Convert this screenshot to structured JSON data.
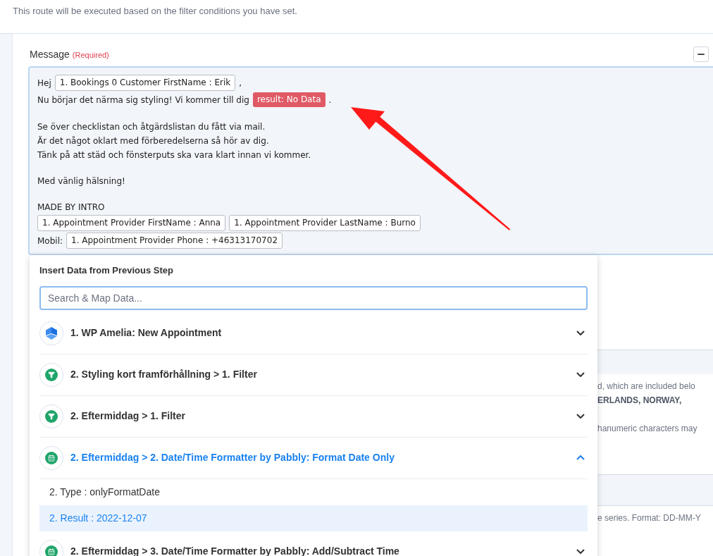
{
  "route_note": "This route will be executed based on the filter conditions you have set.",
  "message": {
    "label": "Message",
    "required": "(Required)",
    "paragraphs": [
      [
        [
          {
            "kind": "text",
            "text": "Hej"
          },
          {
            "kind": "token",
            "text": "1. Bookings 0 Customer FirstName : Erik"
          },
          {
            "kind": "text",
            "text": ","
          }
        ],
        [
          {
            "kind": "text",
            "text": "Nu börjar det närma sig styling! Vi kommer till dig"
          },
          {
            "kind": "error",
            "text": "result: No Data"
          },
          {
            "kind": "text",
            "text": "."
          }
        ]
      ],
      [
        [
          {
            "kind": "text",
            "text": "Se över checklistan och åtgärdslistan du fått via mail."
          }
        ],
        [
          {
            "kind": "text",
            "text": "Är det något oklart med förberedelserna så hör av dig."
          }
        ],
        [
          {
            "kind": "text",
            "text": "Tänk på att städ och fönsterputs ska vara klart innan vi kommer."
          }
        ]
      ],
      [
        [
          {
            "kind": "text",
            "text": "Med vänlig hälsning!"
          }
        ]
      ],
      [
        [
          {
            "kind": "text",
            "text": "MADE BY INTRO"
          }
        ],
        [
          {
            "kind": "token",
            "text": "1. Appointment Provider FirstName : Anna"
          },
          {
            "kind": "token",
            "text": "1. Appointment Provider LastName : Burno"
          }
        ],
        [
          {
            "kind": "text",
            "text": "Mobil:"
          },
          {
            "kind": "token",
            "text": "1. Appointment Provider Phone : +46313170702"
          }
        ]
      ]
    ]
  },
  "background_sections": [
    {
      "lines": [
        {
          "text": "d, which are included belo",
          "bold": false
        },
        {
          "text": "ERLANDS, NORWAY,",
          "bold": true
        },
        {
          "text": "hanumeric characters may",
          "bold": false
        }
      ]
    },
    {
      "lines": [
        {
          "text": "e series. Format: DD-MM-Y",
          "bold": false
        }
      ]
    }
  ],
  "insert_panel": {
    "title": "Insert Data from Previous Step",
    "search": {
      "placeholder": "Search & Map Data..."
    },
    "steps": [
      {
        "kind": "app",
        "label": "1. WP Amelia: New Appointment",
        "expanded": false
      },
      {
        "kind": "filter",
        "label": "2. Styling kort framförhållning > 1. Filter",
        "expanded": false
      },
      {
        "kind": "filter",
        "label": "2. Eftermiddag > 1. Filter",
        "expanded": false
      },
      {
        "kind": "formatter",
        "label": "2. Eftermiddag > 2. Date/Time Formatter by Pabbly: Format Date Only",
        "expanded": true,
        "fields": [
          {
            "text": "2. Type : onlyFormatDate",
            "selected": false
          },
          {
            "text": "2. Result : 2022-12-07",
            "selected": true
          }
        ]
      },
      {
        "kind": "formatter",
        "label": "2. Eftermiddag > 3. Date/Time Formatter by Pabbly: Add/Subtract Time",
        "expanded": false
      }
    ]
  }
}
